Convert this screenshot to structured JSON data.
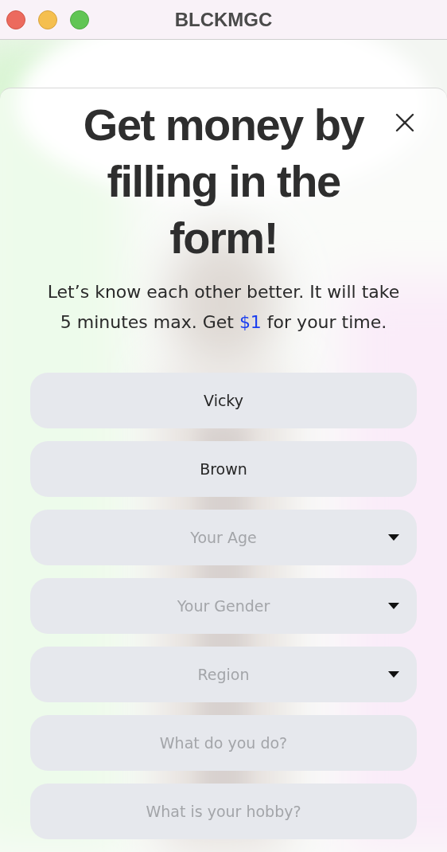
{
  "window": {
    "title": "BLCKMGC"
  },
  "modal": {
    "heading": "Get money by filling in the form!",
    "subtitle": {
      "before": "Let’s know each other better. It will take 5 minutes max. Get ",
      "highlight": "$1",
      "after": " for your time."
    },
    "fields": [
      {
        "kind": "text",
        "value": "Vicky"
      },
      {
        "kind": "text",
        "value": "Brown"
      },
      {
        "kind": "select",
        "placeholder": "Your Age"
      },
      {
        "kind": "select",
        "placeholder": "Your Gender"
      },
      {
        "kind": "select",
        "placeholder": "Region"
      },
      {
        "kind": "text",
        "placeholder": "What do you do?"
      },
      {
        "kind": "text",
        "placeholder": "What is your hobby?"
      }
    ]
  }
}
